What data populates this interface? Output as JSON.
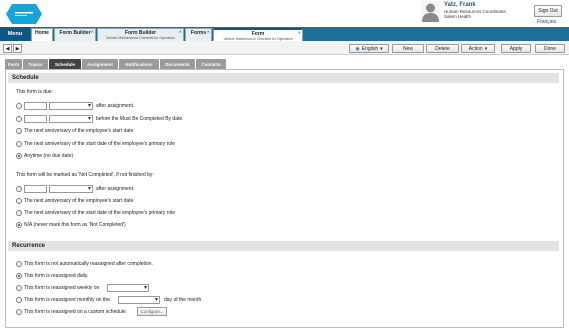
{
  "header": {
    "user_name": "Yatz, Frank",
    "user_title": "Human Resources Coordinator,",
    "user_org": "Salem Health",
    "sign_out": "Sign Out",
    "language_link": "Français"
  },
  "tabs": {
    "menu": "Menu",
    "home": "Home",
    "form_builder_1": {
      "title": "Form Builder",
      "sub": ""
    },
    "form_builder_2": {
      "title": "Form Builder",
      "sub": "Vehicle Maintenance Checklist for Operators"
    },
    "forms": {
      "title": "Forms",
      "sub": ""
    },
    "form": {
      "title": "Form",
      "sub": "Vehicle Maintenance Checklist for Operators"
    },
    "close_glyph": "✕"
  },
  "toolbar": {
    "back": "◀",
    "forward": "▶",
    "language": "English",
    "new": "New",
    "delete": "Delete",
    "action": "Action",
    "apply": "Apply",
    "done": "Done"
  },
  "subtabs": [
    "Form",
    "Topics",
    "Schedule",
    "Assignment",
    "Notifications",
    "Documents",
    "Contacts"
  ],
  "schedule": {
    "heading": "Schedule",
    "due_label": "This form is due:",
    "due_options": {
      "after_assignment": "after assignment.",
      "before_must": "before the Must Be Completed By date.",
      "anniv_start": "The next anniversary of the employee's start date",
      "anniv_role": "The next anniversary of the start date of the employee's primary role",
      "anytime": "Anytime (no due date)"
    },
    "not_completed_label": "This form will be marked as 'Not Completed', if not finished by:",
    "nc_options": {
      "after_assignment": "after assignment.",
      "anniv_start": "The next anniversary of the employee's start date",
      "anniv_role": "The next anniversary of the start date of the employee's primary role",
      "na": "N/A (never mark this form as 'Not Completed')"
    }
  },
  "recurrence": {
    "heading": "Recurrence",
    "not_reassigned": "This form is not automatically reassigned after completion.",
    "daily": "This form is reassigned daily.",
    "weekly": "This form is reassigned weekly on",
    "monthly_pre": "This form is reassigned monthly on the",
    "monthly_post": "day of the month.",
    "custom": "This form is reassigned on a custom schedule.",
    "configure": "Configure..."
  },
  "colors": {
    "tabbar": "#1d6f9a",
    "accent": "#0f5680"
  }
}
